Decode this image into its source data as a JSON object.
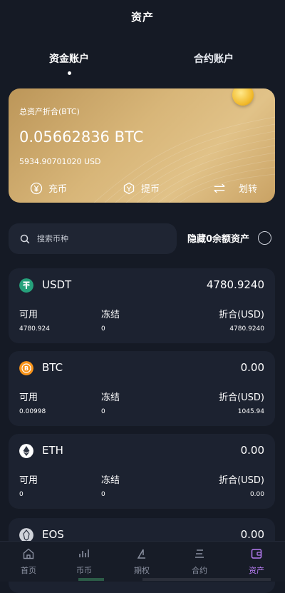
{
  "header": {
    "title": "资产"
  },
  "tabs": [
    {
      "label": "资金账户",
      "active": true
    },
    {
      "label": "合约账户",
      "active": false
    }
  ],
  "card": {
    "label": "总资产折合(BTC)",
    "btc_value": "0.05662836 BTC",
    "usd_value": "5934.90701020 USD",
    "actions": [
      {
        "label": "充币",
        "icon": "yen-circle-icon"
      },
      {
        "label": "提币",
        "icon": "withdraw-icon"
      },
      {
        "label": "划转",
        "icon": "transfer-icon"
      }
    ]
  },
  "search": {
    "placeholder": "搜索币种"
  },
  "hide_zero": {
    "label": "隐藏0余额资产",
    "checked": false
  },
  "assets": [
    {
      "symbol": "USDT",
      "total": "4780.9240",
      "available_label": "可用",
      "frozen_label": "冻结",
      "equiv_label": "折合(USD)",
      "available": "4780.924",
      "frozen": "0",
      "equiv": "4780.9240",
      "color": "#26a17b"
    },
    {
      "symbol": "BTC",
      "total": "0.00",
      "available_label": "可用",
      "frozen_label": "冻结",
      "equiv_label": "折合(USD)",
      "available": "0.00998",
      "frozen": "0",
      "equiv": "1045.94",
      "color": "#f7931a"
    },
    {
      "symbol": "ETH",
      "total": "0.00",
      "available_label": "可用",
      "frozen_label": "冻结",
      "equiv_label": "折合(USD)",
      "available": "0",
      "frozen": "0",
      "equiv": "0.00",
      "color": "#ffffff"
    },
    {
      "symbol": "EOS",
      "total": "0.00",
      "color": "#d0d3da"
    }
  ],
  "nav": [
    {
      "label": "首页",
      "icon": "home-icon",
      "active": false
    },
    {
      "label": "币币",
      "icon": "chart-trend-icon",
      "active": false
    },
    {
      "label": "期权",
      "icon": "options-icon",
      "active": false
    },
    {
      "label": "合约",
      "icon": "contract-icon",
      "active": false
    },
    {
      "label": "资产",
      "icon": "wallet-icon",
      "active": true
    }
  ],
  "colors": {
    "accent": "#b67cf2",
    "background": "#151a25",
    "card_gold": "#d8b679"
  }
}
